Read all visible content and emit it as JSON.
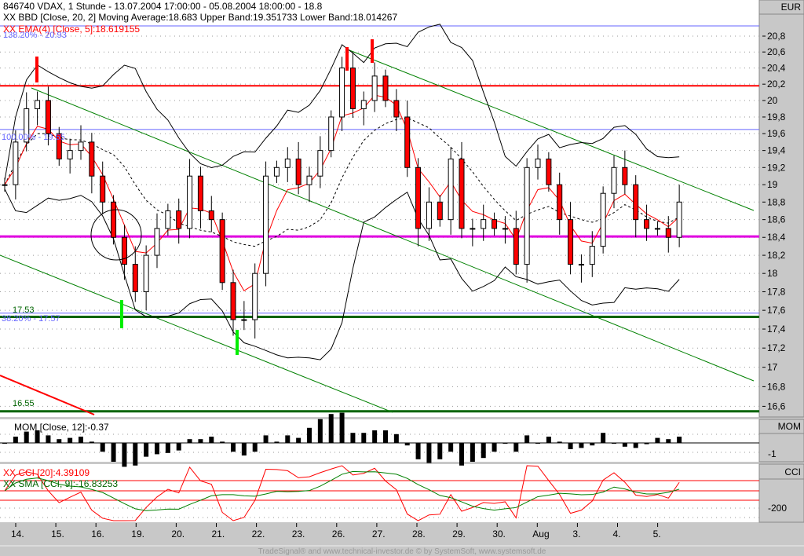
{
  "header": {
    "title": "846740  VDAX, 1 Stunde - 13.07.2004 17:00:00 - 05.08.2004 18:00:00 - 18.8",
    "bbd_legend": "XX BBD [Close, 20, 2] Moving Average:18.683 Upper Band:19.351733 Lower Band:18.014267",
    "ema_legend": "XX EMA(4) [Close, 5]:18.619155"
  },
  "levels": {
    "fib_top": "138.20% - 20.93",
    "fib_100": "100.00% - 19.65",
    "fib_38": "38.20% - 17.57",
    "support_1": "17.53",
    "support_2": "16.55"
  },
  "panels": {
    "price_unit": "EUR",
    "mom_title": "MOM",
    "mom_legend": "MOM [Close, 12]:-0.37",
    "mom_tick": "-1",
    "cci_title": "CCI",
    "cci_legend": "XX CCI [20]:4.39109",
    "sma_legend": "XX SMA [CCI, 9]:-16.83253",
    "cci_tick": "-200"
  },
  "footer": "TradeSignal® and www.technical-investor.de © by  SystemSoft, www.systemsoft.de",
  "colors": {
    "ema": "#ff0000",
    "down": "#ff0000",
    "channel": "#008000",
    "resistance": "#ff0000",
    "pivot": "#e000e0",
    "fib": "#6666ff",
    "support": "#006400"
  },
  "chart_data": {
    "type": "candlestick",
    "title": "846740 VDAX, 1 Stunde",
    "ylabel": "EUR",
    "y_scale": "log",
    "ylim": [
      16.5,
      20.95
    ],
    "y_ticks": [
      "20,8",
      "20,6",
      "20,4",
      "20,2",
      "20",
      "19,8",
      "19,6",
      "19,4",
      "19,2",
      "19",
      "18,8",
      "18,6",
      "18,4",
      "18,2",
      "18",
      "17,8",
      "17,6",
      "17,4",
      "17,2",
      "17",
      "16,8",
      "16,6"
    ],
    "x_ticks": [
      "14.",
      "15.",
      "16.",
      "19.",
      "20.",
      "21.",
      "22.",
      "23.",
      "26.",
      "27.",
      "28.",
      "29.",
      "30.",
      "Aug",
      "3.",
      "4.",
      "5."
    ],
    "closes": [
      19.0,
      19.5,
      19.9,
      20.0,
      19.6,
      19.3,
      19.4,
      19.5,
      19.1,
      18.8,
      18.4,
      18.1,
      17.8,
      18.2,
      18.5,
      18.7,
      18.5,
      19.1,
      18.7,
      18.6,
      17.9,
      17.5,
      17.5,
      18.0,
      19.1,
      19.2,
      19.3,
      19.0,
      19.1,
      19.4,
      19.8,
      20.4,
      19.9,
      20.0,
      20.3,
      20.0,
      19.8,
      19.2,
      18.5,
      18.8,
      18.6,
      19.3,
      18.5,
      18.5,
      18.6,
      18.5,
      18.5,
      18.1,
      19.2,
      19.3,
      19.0,
      18.6,
      18.1,
      18.1,
      18.3,
      18.9,
      19.2,
      19.0,
      18.6,
      18.5,
      18.5,
      18.4,
      18.8
    ],
    "horizontal_levels": {
      "resistance": 20.18,
      "pivot": 18.41,
      "fib_top": 20.93,
      "fib_100": 19.65,
      "fib_38": 17.57,
      "support_1": 17.53,
      "support_2": 16.55
    }
  }
}
